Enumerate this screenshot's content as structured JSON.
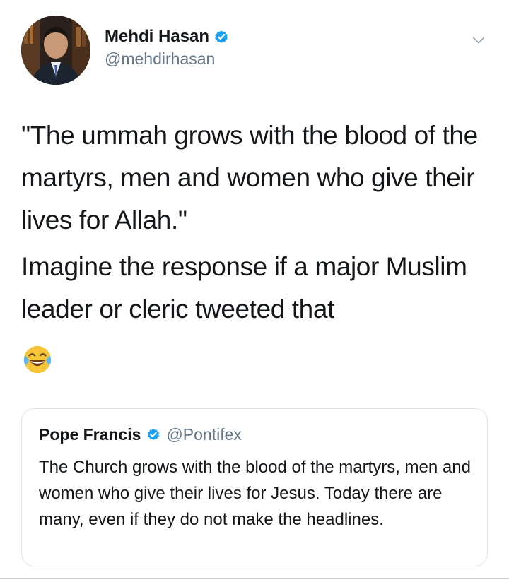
{
  "tweet": {
    "author": {
      "display_name": "Mehdi Hasan",
      "handle": "@mehdirhasan",
      "verified": true
    },
    "text_paragraph_1": "\"The ummah grows with the blood of the martyrs, men and women who give their lives for Allah.\"",
    "text_paragraph_2": "Imagine the response if a major Muslim leader or cleric tweeted that",
    "emoji": "face-with-tears-of-joy",
    "menu_icon": "chevron-down-icon"
  },
  "quoted_tweet": {
    "display_name": "Pope Francis",
    "handle": "@Pontifex",
    "verified": true,
    "text": "The Church grows with the blood of the martyrs, men and women who give their lives for Jesus. Today there are many, even if they do not make the headlines."
  },
  "colors": {
    "text": "#14171a",
    "secondary_text": "#657786",
    "verified_blue": "#1da1f2",
    "border": "#dfe4e8"
  }
}
